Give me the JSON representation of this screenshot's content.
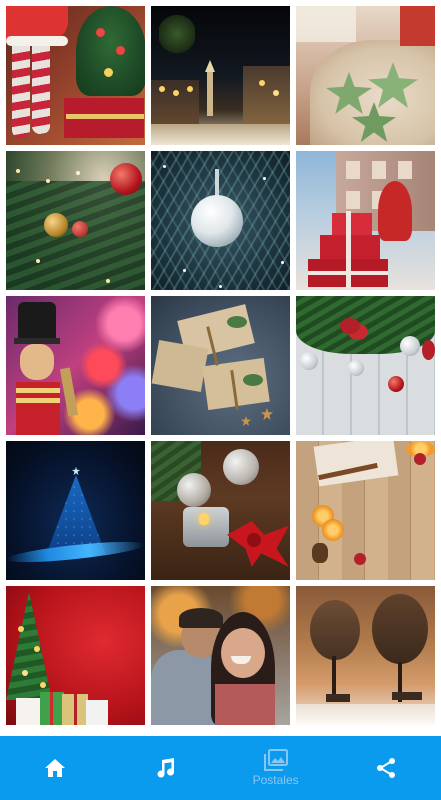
{
  "gallery": {
    "tiles": [
      {
        "subject": "santa-stockings-tree"
      },
      {
        "subject": "night-town-christmas"
      },
      {
        "subject": "gingerbread-cookies"
      },
      {
        "subject": "tree-red-ornament"
      },
      {
        "subject": "silver-bauble-snow"
      },
      {
        "subject": "red-gift-boxes-snow"
      },
      {
        "subject": "toy-soldier-bokeh"
      },
      {
        "subject": "kraft-gifts-stars"
      },
      {
        "subject": "pine-garland-wood"
      },
      {
        "subject": "blue-light-tree"
      },
      {
        "subject": "candles-red-bow"
      },
      {
        "subject": "orange-spice-wood"
      },
      {
        "subject": "tree-gifts-red-wall"
      },
      {
        "subject": "couple-embrace"
      },
      {
        "subject": "snowy-park-lights"
      }
    ]
  },
  "bottom_nav": {
    "items": [
      {
        "icon": "home-icon",
        "label": ""
      },
      {
        "icon": "music-note-icon",
        "label": ""
      },
      {
        "icon": "postcards-icon",
        "label": "Postales"
      },
      {
        "icon": "share-icon",
        "label": ""
      }
    ],
    "colors": {
      "bar": "#0a9aee",
      "icon": "#ffffff",
      "inactive_label": "#86c8f3"
    }
  }
}
